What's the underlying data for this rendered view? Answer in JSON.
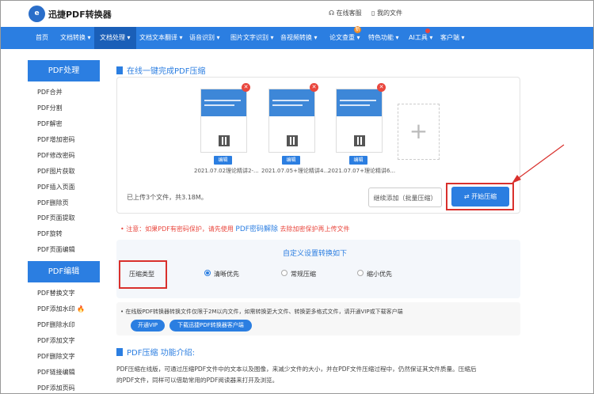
{
  "header": {
    "logo_mark": "e",
    "logo_text": "迅捷PDF转换器",
    "service": "在线客服",
    "my_files": "我的文件"
  },
  "nav": {
    "items": [
      "首页",
      "文档转换",
      "文档处理",
      "文档文本翻译",
      "语音识别",
      "图片文字识别",
      "音视频转换",
      "论文查重",
      "特色功能",
      "AI工具",
      "客户端"
    ],
    "badge_new": "新",
    "badge_hot": "•"
  },
  "sidebar": {
    "pdf_process": {
      "title": "PDF处理",
      "items": [
        "PDF合并",
        "PDF分割",
        "PDF解密",
        "PDF增加密码",
        "PDF修改密码",
        "PDF图片获取",
        "PDF插入页面",
        "PDF删除页",
        "PDF页面提取",
        "PDF旋转",
        "PDF页面编辑"
      ]
    },
    "pdf_edit": {
      "title": "PDF编辑",
      "items": [
        "PDF替换文字",
        "PDF添加水印",
        "PDF删除水印",
        "PDF添加文字",
        "PDF删除文字",
        "PDF链接编辑",
        "PDF添加页码"
      ]
    }
  },
  "main": {
    "title": "在线一键完成PDF压缩",
    "files": [
      {
        "name": "2021.07.02理论精讲2-...",
        "edit": "编辑",
        "thumb_title": "理论精讲2 精讲精练一高中英"
      },
      {
        "name": "2021.07.05+理论精讲4...",
        "edit": "编辑",
        "thumb_title": "理论精讲4 精讲精练一高中"
      },
      {
        "name": "2021.07.07+理论精讲6...",
        "edit": "编辑",
        "thumb_title": "理论精讲6 精讲精练一高中"
      }
    ],
    "status": "已上传3个文件，共3.18M。",
    "add_more": "继续添加（批量压缩）",
    "start": "开始压缩",
    "note_prefix": "注意：如果PDF有密码保护，请先使用",
    "note_link": "PDF密码解除",
    "note_suffix": "去除加密保护再上传文件",
    "settings_title": "自定义设置转换如下",
    "compress_type_label": "压缩类型",
    "options": [
      "清晰优先",
      "常规压缩",
      "缩小优先"
    ],
    "selected_option": "清晰优先",
    "vip_note": "在线版PDF转换器转换文件仅限于2M以内文件，如需转换更大文件、转换更多格式文件，请开通VIP或下载客户端",
    "vip_button": "开通VIP",
    "download_button": "下载迅捷PDF转换器客户端",
    "intro_title": "PDF压缩 功能介绍:",
    "intro_line1": "PDF压缩在线版，可通过压缩PDF文件中的文本以及图像，来减少文件的大小，并在PDF文件压缩过程中，仍然保证其文件质量。压缩后",
    "intro_line2": "的PDF文件，同样可以借助常用的PDF阅读器来打开及浏览。"
  },
  "colors": {
    "accent": "#2b7ee1",
    "nav_active": "#1a5fb8",
    "alert": "#d9302c"
  }
}
